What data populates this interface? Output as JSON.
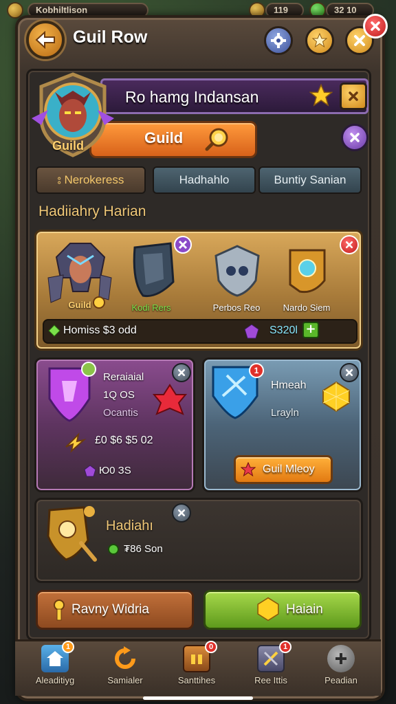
{
  "topbar": {
    "player_name": "Kobhiltlison",
    "level": "119",
    "currency": "32 10"
  },
  "header": {
    "title": "Guil Row"
  },
  "banner": {
    "title": "Ro hamg Indansan",
    "emblem_label": "Guild",
    "guild_button": "Guild"
  },
  "tabs": [
    {
      "label": "Nerokeress",
      "active": true
    },
    {
      "label": "Hadhahlo",
      "active": false
    },
    {
      "label": "Buntiy Sanian",
      "active": false
    }
  ],
  "section_title": "Hadiiahry Harian",
  "reward_card": {
    "items": [
      {
        "label": "Guild",
        "icon": "hero-portrait-icon"
      },
      {
        "label": "Kodi Rers",
        "icon": "dark-shield-icon"
      },
      {
        "label": "Perbos Reo",
        "icon": "silver-shield-icon"
      },
      {
        "label": "Nardo Siem",
        "icon": "gold-shield-icon"
      }
    ],
    "footer_left": "Homiss $3 odd",
    "footer_right": "S320l"
  },
  "card_purple": {
    "line1": "Reraiaial",
    "line2": "1Q OS",
    "line3": "Ocantis",
    "amount": "£0 $6 $5 02",
    "sub": "Ю0 ЗS",
    "badge_color": "#8bc34a"
  },
  "card_blue": {
    "line1": "Hmeah",
    "line2": "Lrayln",
    "badge": "1",
    "button": "Guil Mleoy"
  },
  "card_dark": {
    "title": "Hadiahı",
    "sub": "₮86 Son"
  },
  "buttons": {
    "left": "Ravny Widria",
    "right": "Haiain"
  },
  "nav": [
    {
      "label": "Aleaditiyg",
      "icon": "home-icon",
      "badge": "1"
    },
    {
      "label": "Samialer",
      "icon": "refresh-icon",
      "badge": ""
    },
    {
      "label": "Santtihes",
      "icon": "chest-icon",
      "badge": "0"
    },
    {
      "label": "Ree Ittis",
      "icon": "scroll-icon",
      "badge": "1"
    },
    {
      "label": "Peadian",
      "icon": "gear-icon",
      "badge": ""
    }
  ],
  "colors": {
    "accent_orange": "#e27a12",
    "accent_green": "#5e9a1c",
    "close_red": "#c11c1c"
  }
}
